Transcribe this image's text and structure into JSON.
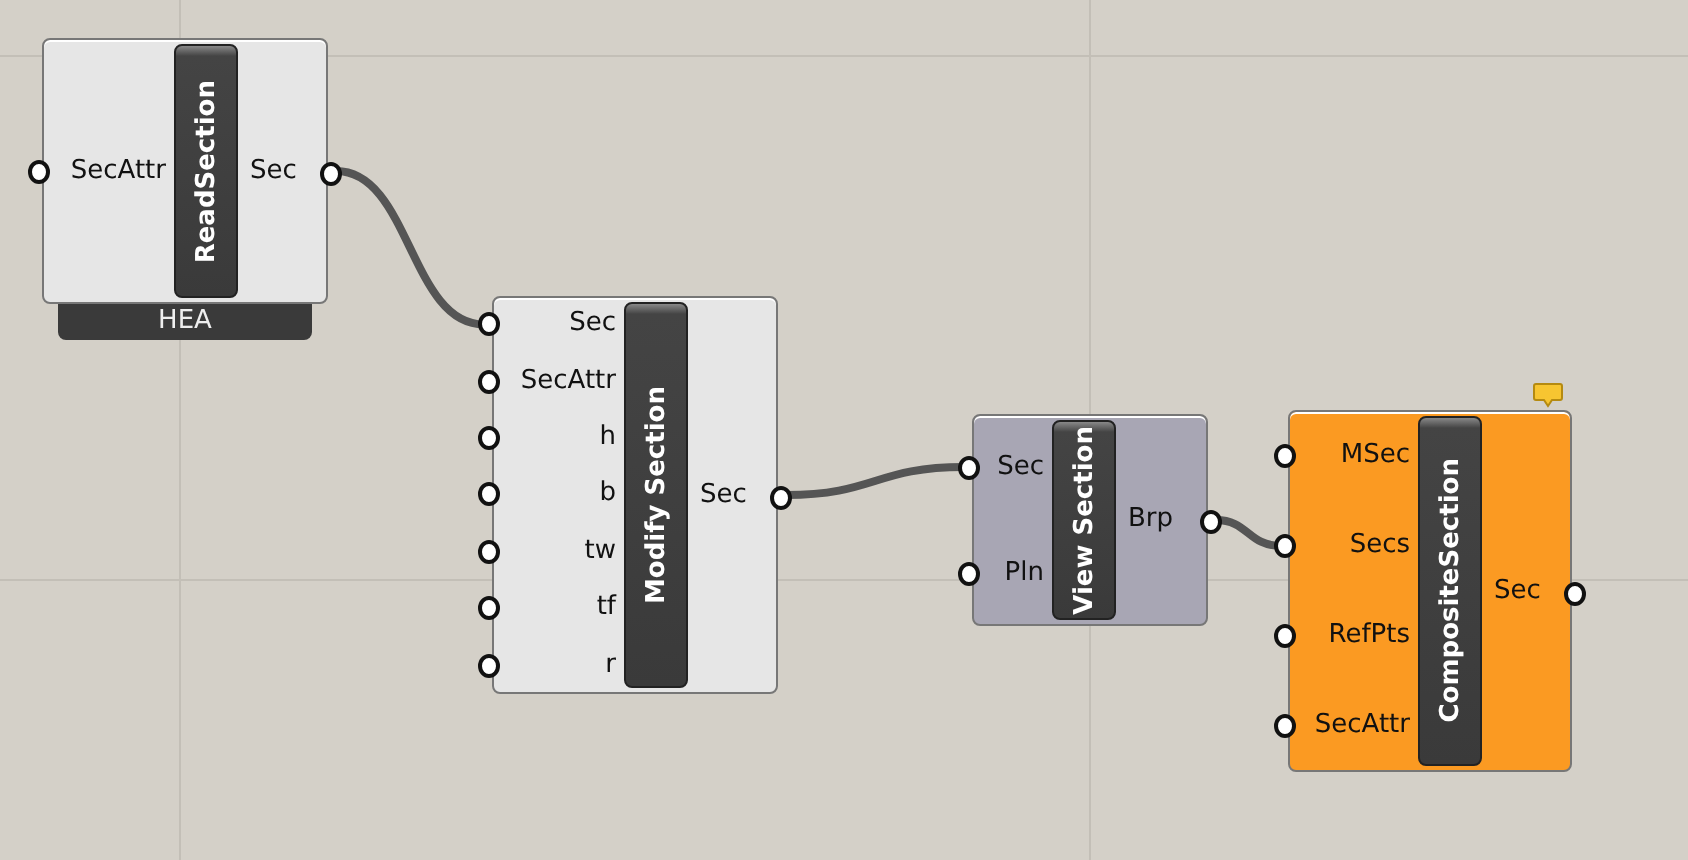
{
  "nodes": [
    {
      "title": "ReadSection",
      "color": "#e6e6e6",
      "inputs": [
        "SecAttr"
      ],
      "outputs": [
        "Sec"
      ],
      "label": "HEA"
    },
    {
      "title": "Modify Section",
      "color": "#e6e6e6",
      "inputs": [
        "Sec",
        "SecAttr",
        "h",
        "b",
        "tw",
        "tf",
        "r"
      ],
      "outputs": [
        "Sec"
      ]
    },
    {
      "title": "View Section",
      "color": "#a8a6b4",
      "inputs": [
        "Sec",
        "Pln"
      ],
      "outputs": [
        "Brp"
      ]
    },
    {
      "title": "CompositeSection",
      "color": "#fb9a22",
      "inputs": [
        "MSec",
        "Secs",
        "RefPts",
        "SecAttr"
      ],
      "outputs": [
        "Sec"
      ],
      "message": true
    }
  ]
}
